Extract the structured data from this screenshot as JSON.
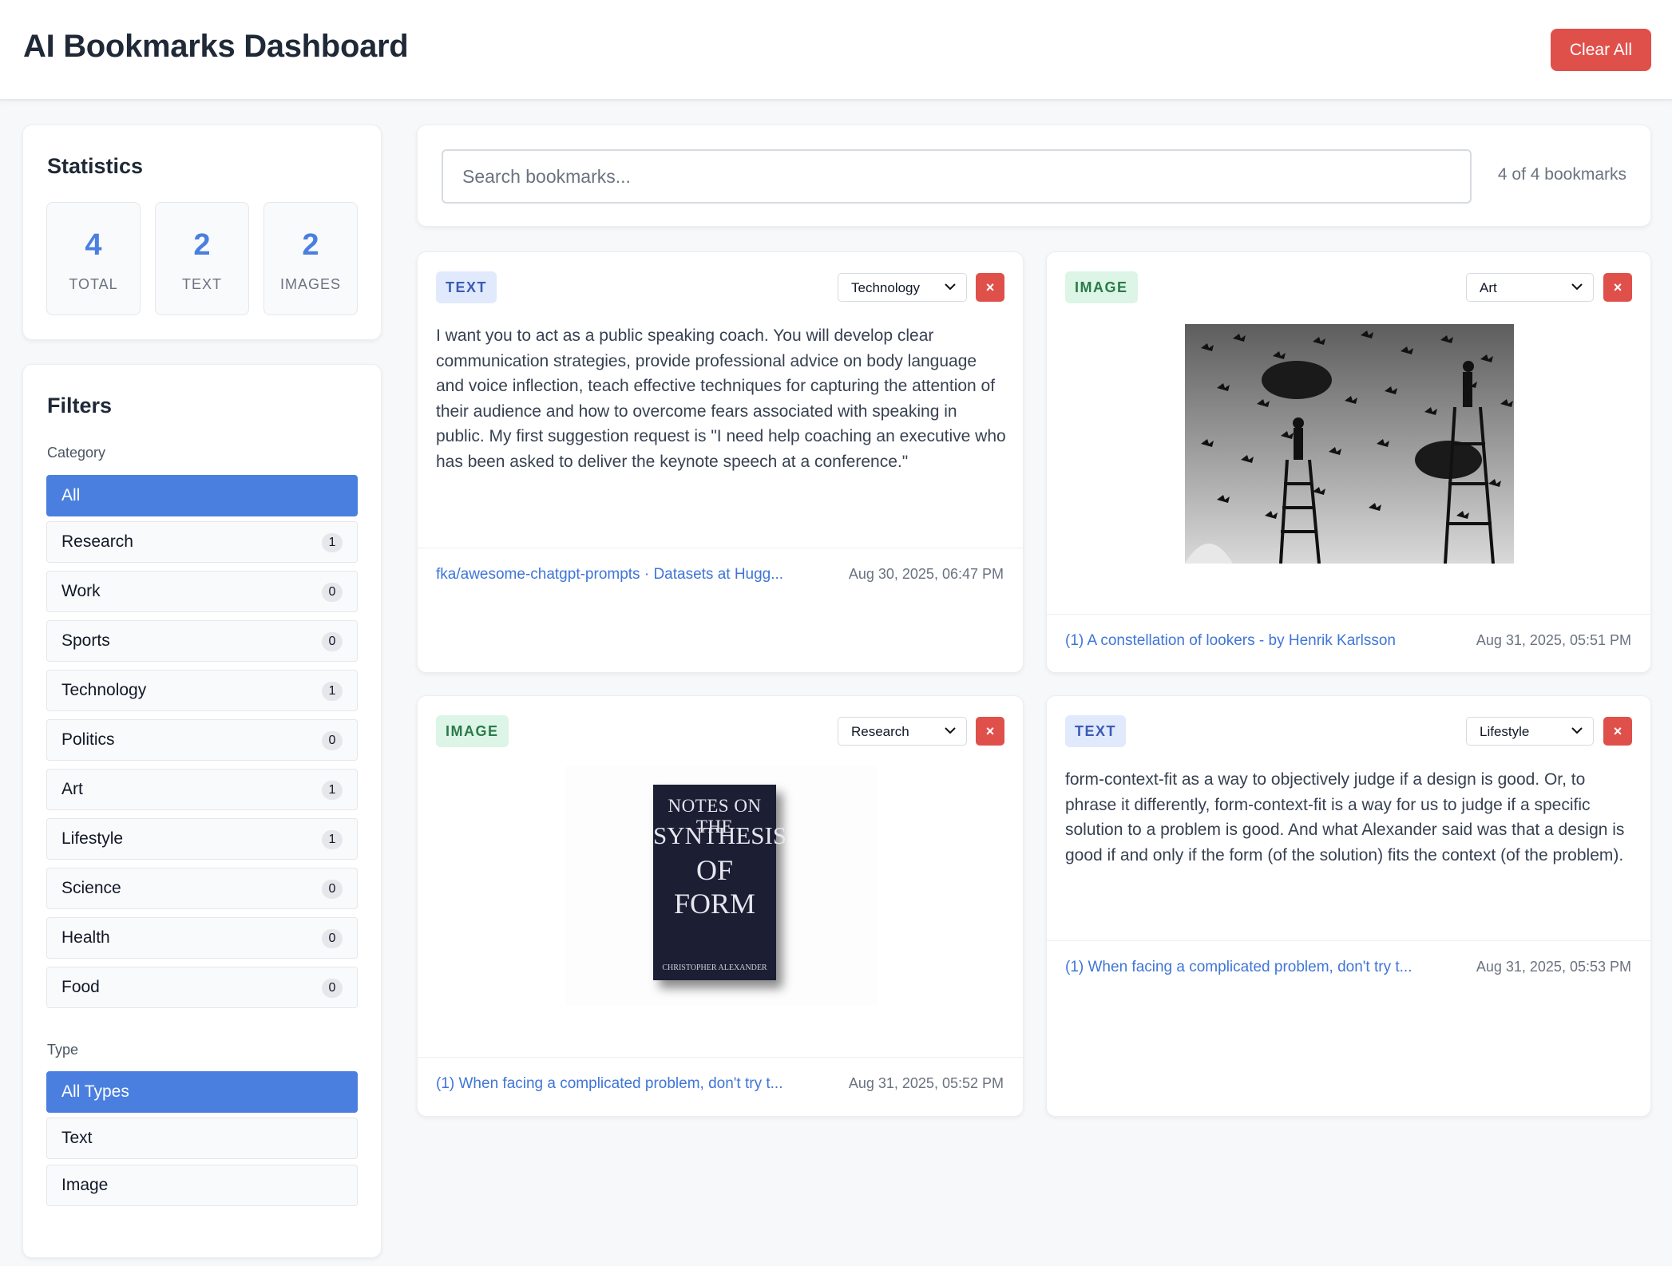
{
  "header": {
    "title": "AI Bookmarks Dashboard",
    "clear_label": "Clear All"
  },
  "stats": {
    "title": "Statistics",
    "items": [
      {
        "value": "4",
        "label": "TOTAL"
      },
      {
        "value": "2",
        "label": "TEXT"
      },
      {
        "value": "2",
        "label": "IMAGES"
      }
    ]
  },
  "filters": {
    "title": "Filters",
    "category_label": "Category",
    "categories": [
      {
        "name": "All",
        "count": ""
      },
      {
        "name": "Research",
        "count": "1"
      },
      {
        "name": "Work",
        "count": "0"
      },
      {
        "name": "Sports",
        "count": "0"
      },
      {
        "name": "Technology",
        "count": "1"
      },
      {
        "name": "Politics",
        "count": "0"
      },
      {
        "name": "Art",
        "count": "1"
      },
      {
        "name": "Lifestyle",
        "count": "1"
      },
      {
        "name": "Science",
        "count": "0"
      },
      {
        "name": "Health",
        "count": "0"
      },
      {
        "name": "Food",
        "count": "0"
      }
    ],
    "type_label": "Type",
    "types": [
      {
        "name": "All Types"
      },
      {
        "name": "Text"
      },
      {
        "name": "Image"
      }
    ]
  },
  "search": {
    "placeholder": "Search bookmarks...",
    "count_text": "4 of 4 bookmarks"
  },
  "cards": [
    {
      "type": "TEXT",
      "category": "Technology",
      "delete_label": "×",
      "text": "I want you to act as a public speaking coach. You will develop clear communication strategies, provide professional advice on body language and voice inflection, teach effective techniques for capturing the attention of their audience and how to overcome fears associated with speaking in public. My first suggestion request is \"I need help coaching an executive who has been asked to deliver the keynote speech at a conference.\"",
      "link": "fka/awesome-chatgpt-prompts · Datasets at Hugg...",
      "date": "Aug 30, 2025, 06:47 PM"
    },
    {
      "type": "IMAGE",
      "category": "Art",
      "delete_label": "×",
      "link": "(1) A constellation of lookers - by Henrik Karlsson",
      "date": "Aug 31, 2025, 05:51 PM"
    },
    {
      "type": "IMAGE",
      "category": "Research",
      "delete_label": "×",
      "book": {
        "line1": "NOTES ON THE",
        "line2": "SYNTHESIS",
        "line3": "OF FORM",
        "author": "CHRISTOPHER ALEXANDER"
      },
      "link": "(1) When facing a complicated problem, don't try t...",
      "date": "Aug 31, 2025, 05:52 PM"
    },
    {
      "type": "TEXT",
      "category": "Lifestyle",
      "delete_label": "×",
      "text": "form-context-fit as a way to objectively judge if a design is good. Or, to phrase it differently, form-context-fit is a way for us to judge if a specific solution to a problem is good. And what Alexander said was that a design is good if and only if the form (of the solution) fits the context (of the problem).",
      "link": "(1) When facing a complicated problem, don't try t...",
      "date": "Aug 31, 2025, 05:53 PM"
    }
  ]
}
